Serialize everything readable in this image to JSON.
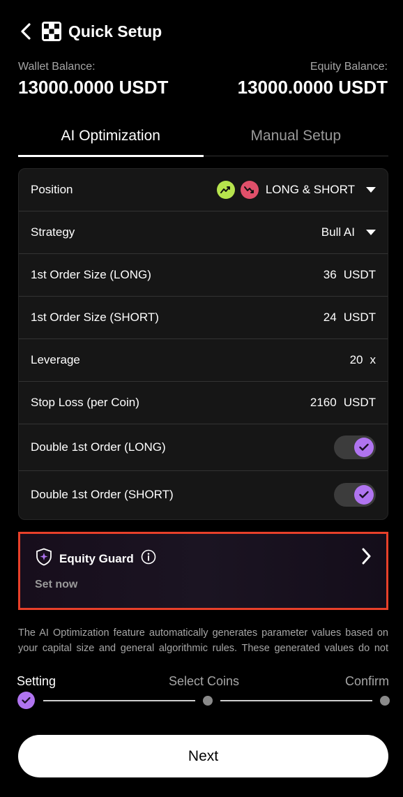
{
  "header": {
    "title": "Quick Setup",
    "back_icon": "chevron-left-icon",
    "logo_icon": "app-logo-icon"
  },
  "balances": {
    "wallet_label": "Wallet Balance:",
    "wallet_value": "13000.0000 USDT",
    "equity_label": "Equity Balance:",
    "equity_value": "13000.0000 USDT"
  },
  "tabs": [
    {
      "label": "AI Optimization",
      "active": true
    },
    {
      "label": "Manual Setup",
      "active": false
    }
  ],
  "settings": {
    "position": {
      "label": "Position",
      "value": "LONG & SHORT"
    },
    "strategy": {
      "label": "Strategy",
      "value": "Bull AI"
    },
    "first_long": {
      "label": "1st Order Size (LONG)",
      "value": "36",
      "unit": "USDT"
    },
    "first_short": {
      "label": "1st Order Size (SHORT)",
      "value": "24",
      "unit": "USDT"
    },
    "leverage": {
      "label": "Leverage",
      "value": "20",
      "unit": "x"
    },
    "stop_loss": {
      "label": "Stop Loss (per Coin)",
      "value": "2160",
      "unit": "USDT"
    },
    "double_long": {
      "label": "Double 1st Order (LONG)",
      "enabled": true
    },
    "double_short": {
      "label": "Double 1st Order (SHORT)",
      "enabled": true
    }
  },
  "equity_guard": {
    "title": "Equity Guard",
    "subtitle": "Set now"
  },
  "description": "The AI Optimization feature automatically generates parameter values based on your capital size and general algorithmic rules. These generated values do not constitute financial advice or trading recommendations. You",
  "steps": [
    {
      "label": "Setting",
      "state": "done"
    },
    {
      "label": "Select Coins",
      "state": "pending"
    },
    {
      "label": "Confirm",
      "state": "pending"
    }
  ],
  "next_label": "Next",
  "colors": {
    "accent": "#b074f0",
    "long": "#b6e34d",
    "short": "#e0506a",
    "highlight_border": "#e8402a"
  }
}
